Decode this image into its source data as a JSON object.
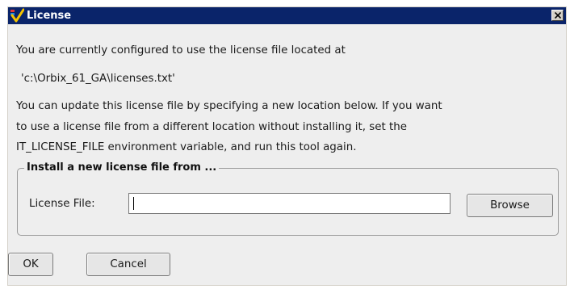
{
  "window": {
    "title": "License",
    "close_label": "X"
  },
  "message": {
    "line1": "You are currently configured to use the license file located at",
    "path": "'c:\\Orbix_61_GA\\licenses.txt'",
    "line3": "You can update this license file by specifying a new location below. If you want",
    "line4": "to use a license file from a different location without installing it, set the",
    "line5": "IT_LICENSE_FILE environment variable, and run this tool again."
  },
  "install_group": {
    "legend": "Install a new license file from ...",
    "license_file_label": "License File:",
    "license_file_value": "",
    "browse_label": "Browse"
  },
  "buttons": {
    "ok_label": "OK",
    "cancel_label": "Cancel"
  },
  "colors": {
    "titlebar": "#0a246a",
    "window_bg": "#eeeeee",
    "logo_check": "#f5c400",
    "logo_bg": "#d32f2f"
  },
  "icons": {
    "app_logo": "app-logo-icon",
    "close": "close-icon"
  }
}
